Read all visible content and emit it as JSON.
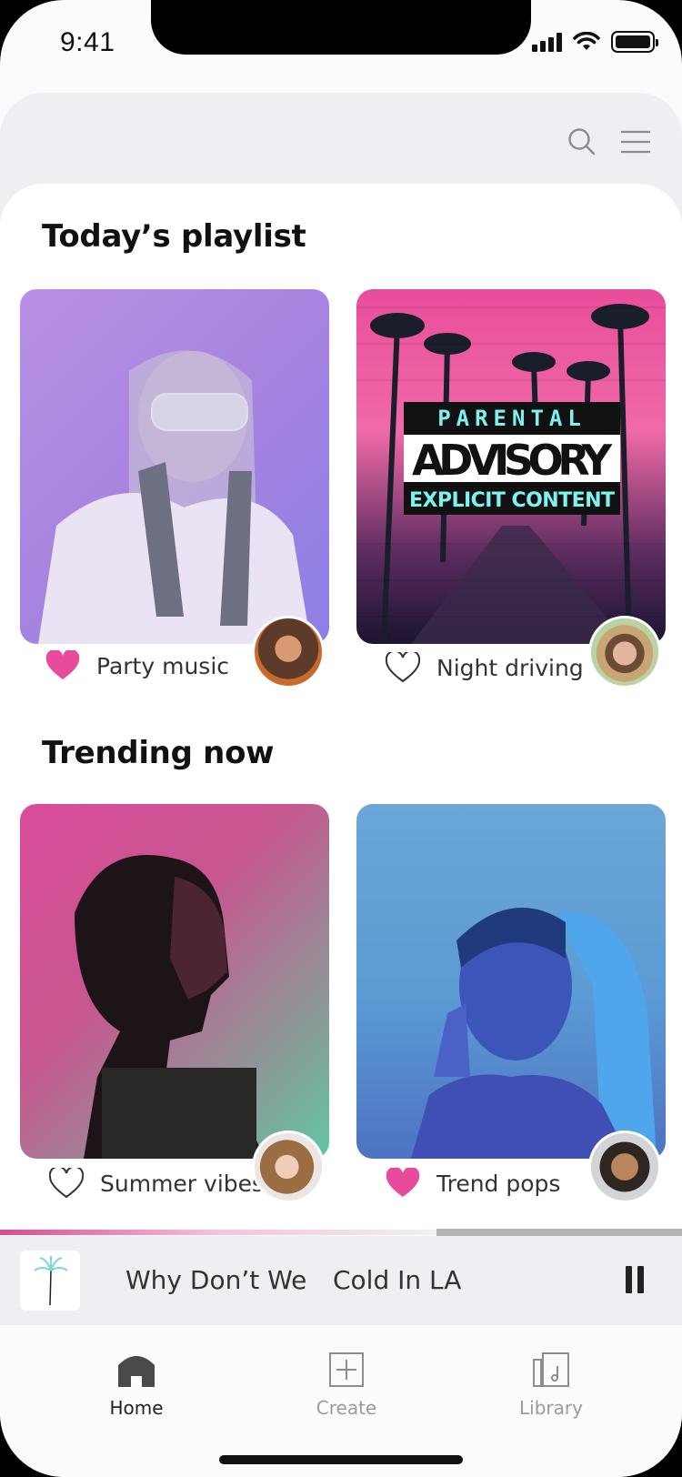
{
  "status_bar": {
    "time": "9:41"
  },
  "header": {
    "search_icon": "search-icon",
    "menu_icon": "hamburger-menu-icon"
  },
  "sections": {
    "todays_playlist": {
      "title": "Today’s playlist",
      "cards": [
        {
          "label": "Party music",
          "liked": true
        },
        {
          "label": "Night driving",
          "liked": false
        }
      ]
    },
    "trending_now": {
      "title": "Trending now",
      "cards": [
        {
          "label": "Summer vibes",
          "liked": false
        },
        {
          "label": "Trend pops",
          "liked": true
        }
      ]
    }
  },
  "player": {
    "title": "Why Don’t We",
    "artist": "Cold In LA",
    "progress": 0.64,
    "pause_icon": "pause-icon"
  },
  "tabbar": {
    "items": [
      {
        "label": "Home",
        "icon": "home-icon",
        "active": true
      },
      {
        "label": "Create",
        "icon": "plus-square-icon",
        "active": false
      },
      {
        "label": "Library",
        "icon": "library-icon",
        "active": false
      }
    ]
  },
  "colors": {
    "accent_pink": "#e84a9c",
    "text_dark": "#111111",
    "inactive_gray": "#9b9a9e",
    "header_bg": "#efeef2"
  }
}
